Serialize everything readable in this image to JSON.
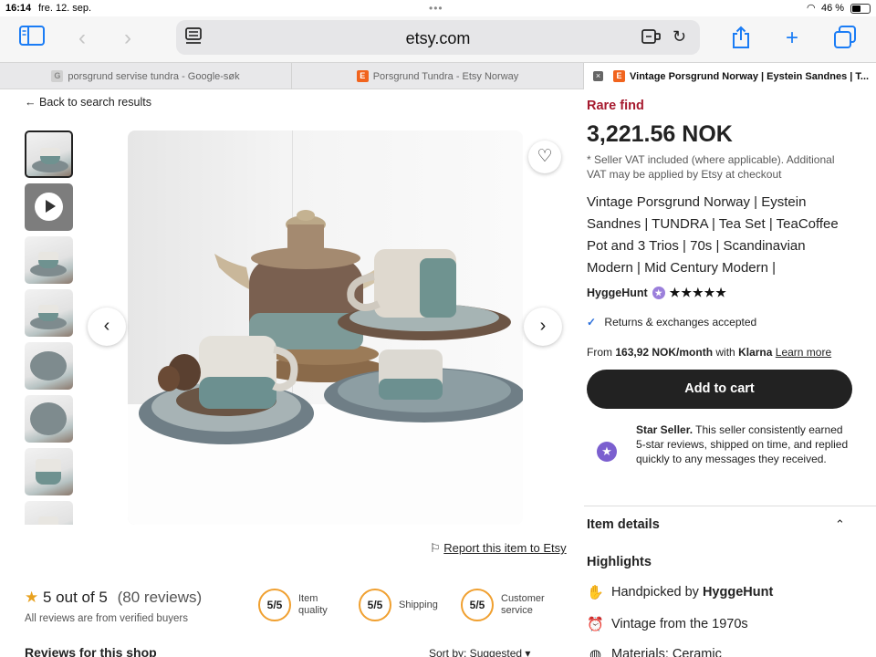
{
  "status": {
    "time": "16:14",
    "date": "fre. 12. sep.",
    "battery": "46 %"
  },
  "browser": {
    "url": "etsy.com",
    "tabs": [
      {
        "label": "porsgrund servise tundra - Google-søk"
      },
      {
        "label": "Porsgrund Tundra - Etsy Norway"
      },
      {
        "label": "Vintage Porsgrund Norway | Eystein Sandnes | T..."
      }
    ]
  },
  "page": {
    "back_link": "Back to search results",
    "report_link": "Report this item to Etsy"
  },
  "reviews": {
    "rating": "5 out of 5",
    "count": "(80 reviews)",
    "verified": "All reviews are from verified buyers",
    "scores": [
      {
        "value": "5/5",
        "label_1": "Item",
        "label_2": "quality"
      },
      {
        "value": "5/5",
        "label_1": "Shipping",
        "label_2": ""
      },
      {
        "value": "5/5",
        "label_1": "Customer",
        "label_2": "service"
      }
    ],
    "shop_reviews_heading": "Reviews for this shop",
    "sort_label": "Sort by: Suggested"
  },
  "listing": {
    "badge": "Rare find",
    "price": "3,221.56 NOK",
    "vat_note": "* Seller VAT included (where applicable). Additional VAT may be applied by Etsy at checkout",
    "title": "Vintage Porsgrund Norway | Eystein Sandnes | TUNDRA | Tea Set | TeaCoffee Pot and 3 Trios | 70s | Scandinavian Modern | Mid Century Modern |",
    "shop_name": "HyggeHunt",
    "shop_stars": "★★★★★",
    "returns": "Returns & exchanges accepted",
    "klarna_prefix": "From ",
    "klarna_amount": "163,92 NOK/month",
    "klarna_with": " with ",
    "klarna_brand": "Klarna",
    "klarna_link": "Learn more",
    "cart_button": "Add to cart",
    "star_seller_title": "Star Seller.",
    "star_seller_text": " This seller consistently earned 5-star reviews, shipped on time, and replied quickly to any messages they received.",
    "item_details": "Item details",
    "highlights_heading": "Highlights",
    "highlight_handpicked_prefix": "Handpicked by ",
    "highlight_handpicked_shop": "HyggeHunt",
    "highlight_vintage": "Vintage from the 1970s",
    "highlight_materials": "Materials: Ceramic"
  },
  "colors": {
    "accent": "#f1641e",
    "rare": "#a61a2e",
    "link": "#1a7cf5",
    "star": "#e8a11f"
  }
}
